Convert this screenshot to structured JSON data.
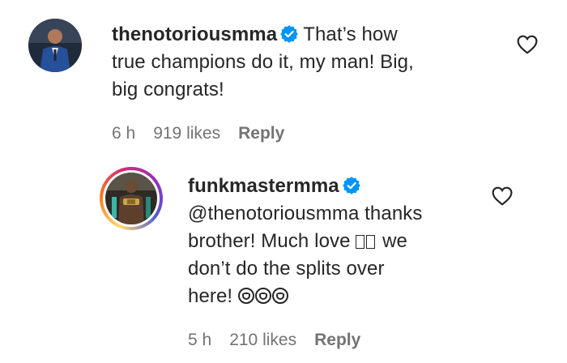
{
  "comments": [
    {
      "username": "thenotoriousmma",
      "verified": true,
      "text_lines": [
        "That’s how",
        "true champions do it, my man! Big,",
        "big congrats!"
      ],
      "time": "6 h",
      "likes": "919 likes",
      "reply_label": "Reply"
    }
  ],
  "reply": {
    "username": "funkmastermma",
    "verified": true,
    "mention": "@thenotoriousmma",
    "line1_rest": " thanks",
    "line2_start": "brother! Much love ",
    "line2_end": " we",
    "line3": "don’t do the splits over",
    "line4": "here! ",
    "time": "5 h",
    "likes": "210 likes",
    "reply_label": "Reply"
  },
  "colors": {
    "text": "#262626",
    "meta": "#737373",
    "verified_badge": "#0095f6"
  },
  "icons": {
    "like": "heart-outline-icon",
    "verified": "verified-badge-icon"
  }
}
